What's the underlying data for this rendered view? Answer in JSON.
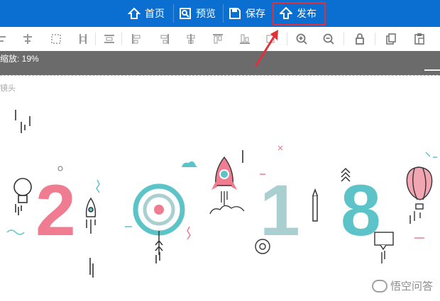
{
  "topbar": {
    "background": "#0a6fd1",
    "buttons": [
      {
        "label": "首页",
        "icon": "home-icon"
      },
      {
        "label": "预览",
        "icon": "preview-icon"
      },
      {
        "label": "保存",
        "icon": "save-icon"
      },
      {
        "label": "发布",
        "icon": "publish-icon"
      }
    ]
  },
  "toolbar": {
    "tools": [
      "align-left-icon",
      "align-center-vertical-icon",
      "distribute-icon",
      "align-right-icon",
      "distribute-horizontal-icon",
      "align-top-icon",
      "align-middle-icon",
      "align-bottom-icon",
      "align-top-edge-icon",
      "align-bottom-edge-icon",
      "align-end-icon",
      "zoom-in-icon",
      "zoom-out-icon",
      "lock-icon",
      "copy-icon",
      "paste-icon"
    ]
  },
  "zoom": {
    "label": "缩放: 19%"
  },
  "layer": {
    "label": "镜头"
  },
  "canvas": {
    "digits": [
      "2",
      "0",
      "1",
      "8"
    ],
    "colors": {
      "pink": "#ef7c91",
      "teal": "#5cc4c8",
      "grey_teal": "#a9cfd0",
      "dark": "#333333"
    }
  },
  "annotation": {
    "highlight_color": "#e0303a"
  },
  "watermark": {
    "text": "悟空问答"
  }
}
